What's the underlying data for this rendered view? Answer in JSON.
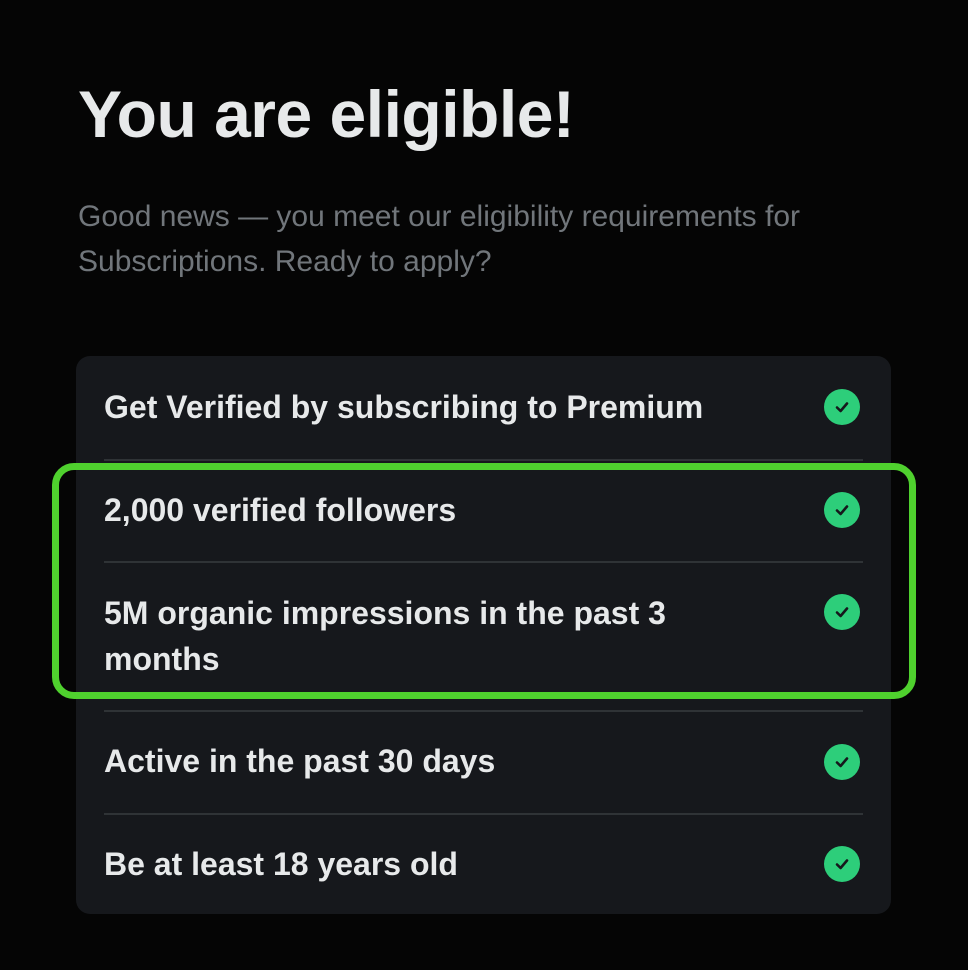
{
  "header": {
    "title": "You are eligible!",
    "subtitle": "Good news — you meet our eligibility requirements for Subscriptions. Ready to apply?"
  },
  "requirements": [
    {
      "label": "Get Verified by subscribing to Premium",
      "status": "met",
      "icon": "check-circle-icon"
    },
    {
      "label": "2,000 verified followers",
      "status": "met",
      "icon": "check-circle-icon"
    },
    {
      "label": "5M organic impressions in the past 3 months",
      "status": "met",
      "icon": "check-circle-icon"
    },
    {
      "label": "Active in the past 30 days",
      "status": "met",
      "icon": "check-circle-icon"
    },
    {
      "label": "Be at least 18 years old",
      "status": "met",
      "icon": "check-circle-icon"
    }
  ],
  "colors": {
    "background": "#050505",
    "card": "#16181c",
    "check": "#2dce7a",
    "highlight": "#4fd12e",
    "subtitle": "#71767b"
  }
}
